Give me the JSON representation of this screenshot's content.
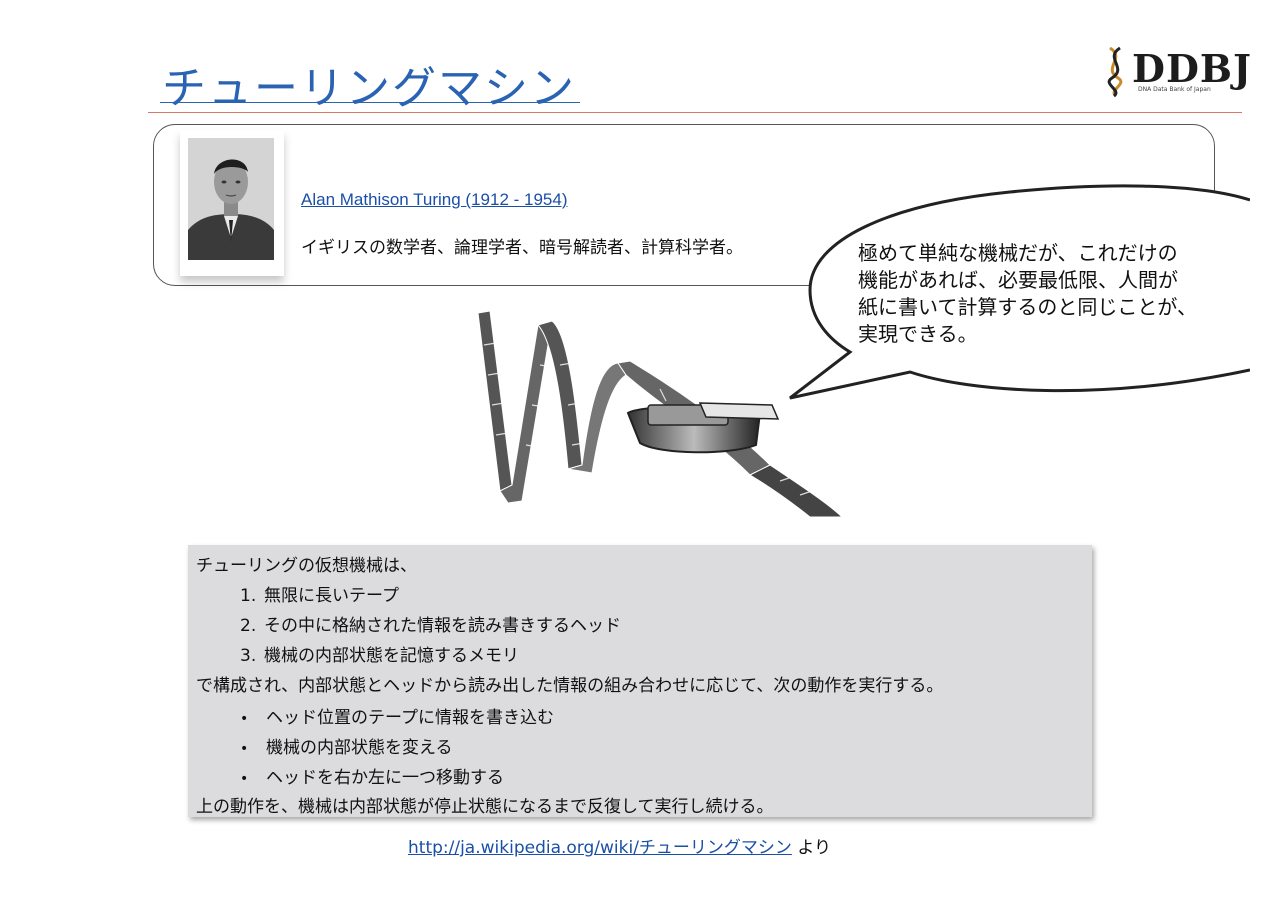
{
  "slide": {
    "title": "チューリングマシン"
  },
  "logo": {
    "text": "DDBJ",
    "subtitle": "DNA Data Bank of Japan"
  },
  "profile": {
    "name_link": "Alan Mathison Turing (1912 - 1954)",
    "description": "イギリスの数学者、論理学者、暗号解読者、計算科学者。"
  },
  "callout": {
    "lines": [
      "極めて単純な機械だが、これだけの",
      "機能があれば、必要最低限、人間が",
      "紙に書いて計算するのと同じことが、",
      "実現できる。"
    ]
  },
  "info": {
    "intro": "チューリングの仮想機械は、",
    "components": [
      {
        "num": "1.",
        "text": "無限に長いテープ"
      },
      {
        "num": "2.",
        "text": "その中に格納された情報を読み書きするヘッド"
      },
      {
        "num": "3.",
        "text": "機械の内部状態を記憶するメモリ"
      }
    ],
    "middle": "で構成され、内部状態とヘッドから読み出した情報の組み合わせに応じて、次の動作を実行する。",
    "bullet_symbol": "•",
    "actions": [
      "ヘッド位置のテープに情報を書き込む",
      "機械の内部状態を変える",
      "ヘッドを右か左に一つ移動する"
    ],
    "conclusion": "上の動作を、機械は内部状態が停止状態になるまで反復して実行し続ける。"
  },
  "source": {
    "link_text": "http://ja.wikipedia.org/wiki/チューリングマシン",
    "suffix": "より"
  },
  "colors": {
    "title_blue": "#2a63b3",
    "link_blue": "#1a4fa8",
    "header_rule": "#d9776a",
    "info_bg": "#dcdcde"
  }
}
